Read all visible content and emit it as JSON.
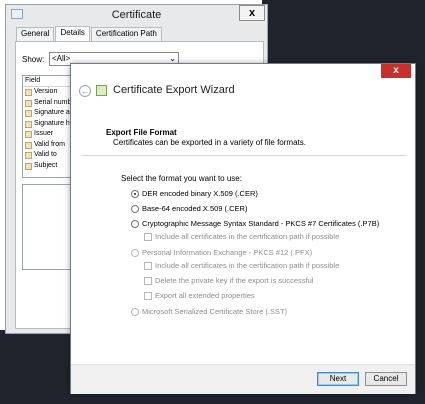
{
  "certificate_window": {
    "title": "Certificate",
    "close_label": "x",
    "tabs": [
      {
        "label": "General"
      },
      {
        "label": "Details"
      },
      {
        "label": "Certification Path"
      }
    ],
    "show_label": "Show:",
    "show_value": "<All>",
    "field_header": "Field",
    "fields": [
      "Version",
      "Serial numb",
      "Signature a",
      "Signature h",
      "Issuer",
      "Valid from",
      "Valid to",
      "Subject"
    ]
  },
  "wizard": {
    "title": "Certificate Export Wizard",
    "close_label": "x",
    "section_title": "Export File Format",
    "section_subtitle": "Certificates can be exported in a variety of file formats.",
    "prompt": "Select the format you want to use:",
    "options": {
      "der": "DER encoded binary X.509 (.CER)",
      "base64": "Base-64 encoded X.509 (.CER)",
      "pkcs7": "Cryptographic Message Syntax Standard - PKCS #7 Certificates (.P7B)",
      "pkcs7_include": "Include all certificates in the certification path if possible",
      "pfx": "Personal Information Exchange - PKCS #12 (.PFX)",
      "pfx_include": "Include all certificates in the certification path if possible",
      "pfx_delete": "Delete the private key if the export is successful",
      "pfx_export_ext": "Export all extended properties",
      "sst": "Microsoft Serialized Certificate Store (.SST)"
    },
    "selected_option": "der",
    "buttons": {
      "next": "Next",
      "cancel": "Cancel"
    }
  }
}
